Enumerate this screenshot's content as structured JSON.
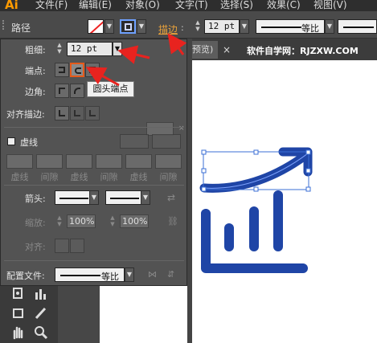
{
  "app": {
    "logo": "Ai"
  },
  "menu": [
    "文件(F)",
    "编辑(E)",
    "对象(O)",
    "文字(T)",
    "选择(S)",
    "效果(C)",
    "视图(V)"
  ],
  "control_bar": {
    "path_label": "路径",
    "stroke_label": "描边",
    "stroke_weight": "12 pt",
    "profile_label": "等比"
  },
  "stroke_panel": {
    "weight_label": "粗细",
    "weight_value": "12 pt",
    "cap_label": "端点",
    "corner_label": "边角",
    "align_label": "对齐描边",
    "dashed_label": "虚线",
    "dash_labels": [
      "虚线",
      "间隙",
      "虚线",
      "间隙",
      "虚线",
      "间隙"
    ],
    "arrowheads_label": "箭头",
    "scale_label": "缩放",
    "scale_start": "100%",
    "scale_end": "100%",
    "align_arrow_label": "对齐",
    "profile_label": "配置文件",
    "profile_value": "等比",
    "tooltip": "圆头端点"
  },
  "document": {
    "tab_label": "预览)",
    "close_symbol": "×",
    "watermark": "软件自学网：RJZXW.COM"
  },
  "colors": {
    "accent_orange": "#e65a1a",
    "icon_blue": "#1f45a6",
    "selection_blue": "#3b6fd6",
    "arrow_red": "#e8231f"
  }
}
